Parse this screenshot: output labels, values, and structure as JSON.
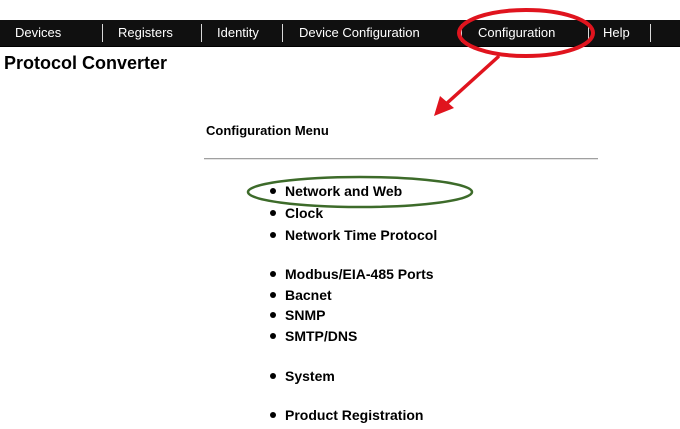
{
  "nav": {
    "items": [
      {
        "label": "Devices"
      },
      {
        "label": "Registers"
      },
      {
        "label": "Identity"
      },
      {
        "label": "Device Configuration"
      },
      {
        "label": "Configuration"
      },
      {
        "label": "Help"
      }
    ]
  },
  "page": {
    "title": "Protocol Converter"
  },
  "menu": {
    "heading": "Configuration Menu",
    "items": [
      {
        "label": "Network and Web"
      },
      {
        "label": "Clock"
      },
      {
        "label": "Network Time Protocol"
      },
      {
        "label": "Modbus/EIA-485 Ports"
      },
      {
        "label": "Bacnet"
      },
      {
        "label": "SNMP"
      },
      {
        "label": "SMTP/DNS"
      },
      {
        "label": "System"
      },
      {
        "label": "Product Registration"
      }
    ]
  },
  "annotations": {
    "highlight_color": "#e0141e",
    "selection_color": "#3d6b2a",
    "arrow_color": "#e0141e"
  }
}
